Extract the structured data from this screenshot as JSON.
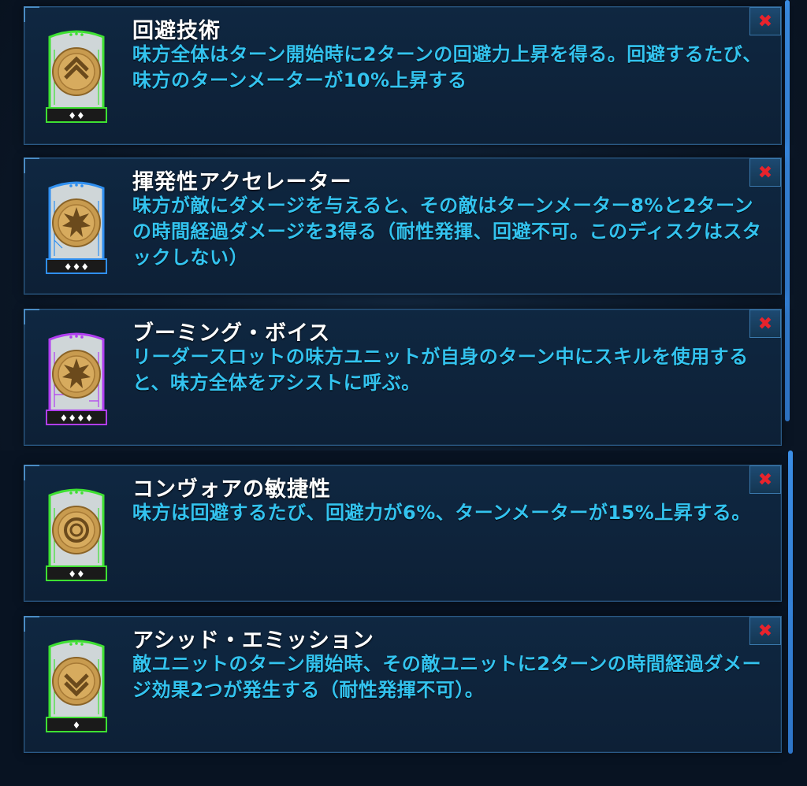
{
  "mods": [
    {
      "title": "回避技術",
      "description": "味方全体はターン開始時に2ターンの回避力上昇を得る。回避するたび、味方のターンメーターが10%上昇する",
      "rarity_color": "#3ee032",
      "dots": "♦♦",
      "icon": "chevron-up-icon",
      "close_label": "✖"
    },
    {
      "title": "揮発性アクセレーター",
      "description": "味方が敵にダメージを与えると、その敵はターンメーター8%と2ターンの時間経過ダメージを3得る（耐性発揮、回避不可。このディスクはスタックしない）",
      "rarity_color": "#2f8ff0",
      "dots": "♦♦♦",
      "icon": "burst-icon",
      "close_label": "✖"
    },
    {
      "title": "ブーミング・ボイス",
      "description": "リーダースロットの味方ユニットが自身のターン中にスキルを使用すると、味方全体をアシストに呼ぶ。",
      "rarity_color": "#b03ef0",
      "dots": "♦♦♦♦",
      "icon": "burst-icon",
      "close_label": "✖"
    },
    {
      "title": "コンヴォアの敏捷性",
      "description": "味方は回避するたび、回避力が6%、ターンメーターが15%上昇する。",
      "rarity_color": "#3ee032",
      "dots": "♦♦",
      "icon": "ring-icon",
      "close_label": "✖"
    },
    {
      "title": "アシッド・エミッション",
      "description": "敵ユニットのターン開始時、その敵ユニットに2ターンの時間経過ダメージ効果2つが発生する（耐性発揮不可）。",
      "rarity_color": "#3ee032",
      "dots": "♦",
      "icon": "chevron-down-icon",
      "close_label": "✖"
    }
  ]
}
